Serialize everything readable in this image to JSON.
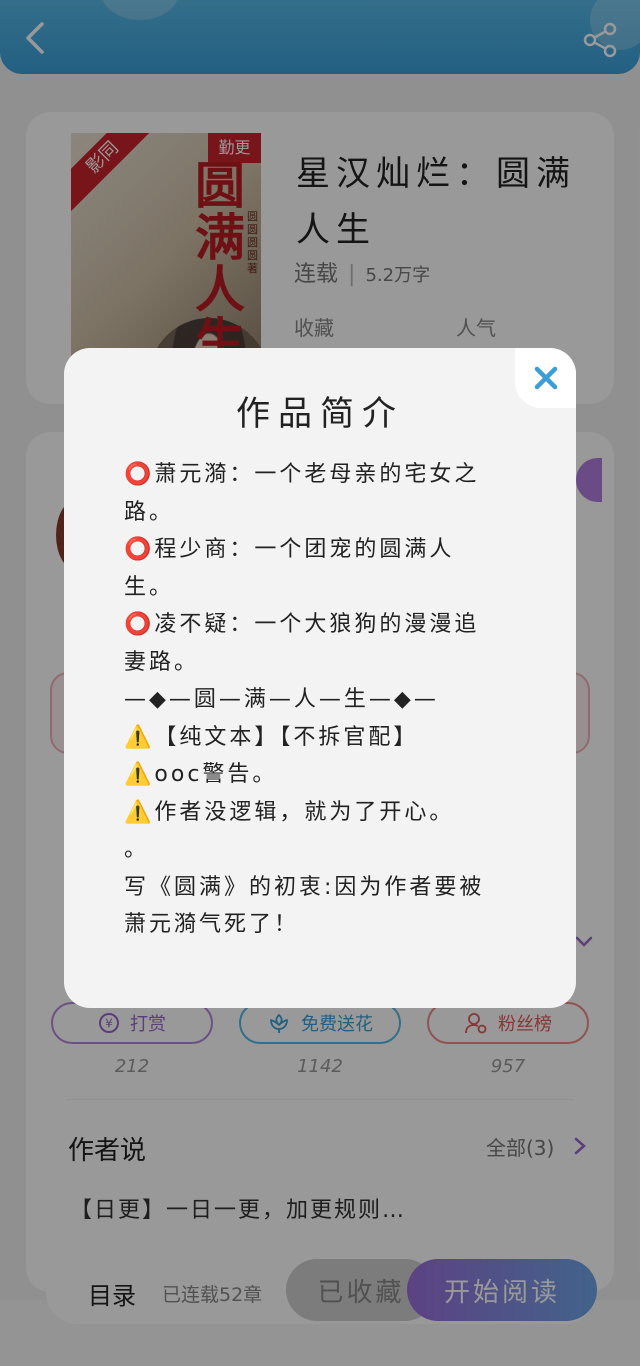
{
  "book": {
    "cover_ribbon": "影同",
    "cover_badge": "勤更",
    "cover_title": "圆满人生",
    "cover_author": "圆圆圆圆著",
    "title": "星汉灿烂：圆满人生",
    "status": "连载",
    "word_count": "5.2万字",
    "stat_favorites_label": "收藏",
    "stat_popularity_label": "人气"
  },
  "actions": [
    {
      "label": "打赏",
      "icon": "yen-coin-icon",
      "count": "212",
      "color": "#9a67cf"
    },
    {
      "label": "免费送花",
      "icon": "flower-icon",
      "count": "1142",
      "color": "#3a9fd8"
    },
    {
      "label": "粉丝榜",
      "icon": "person-badge-icon",
      "count": "957",
      "color": "#e35a5a"
    }
  ],
  "author_says": {
    "title": "作者说",
    "all_label": "全部(3)",
    "text": "【日更】一日一更，加更规则…"
  },
  "bottom_bar": {
    "toc_label": "目录",
    "toc_status": "已连载52章",
    "collected_label": "已收藏",
    "read_label": "开始阅读"
  },
  "modal": {
    "title": "作品简介",
    "lines": [
      "⭕萧元漪：一个老母亲的宅女之",
      "路。",
      "⭕程少商：一个团宠的圆满人",
      "生。",
      "⭕凌不疑：一个大狼狗的漫漫追",
      "妻路。",
      "—◆—圆—满—人—生—◆—",
      "⚠️【纯文本】【不拆官配】",
      "⚠️ooc警告。",
      "⚠️作者没逻辑，就为了开心。",
      "。",
      "写《圆满》的初衷:因为作者要被",
      "萧元漪气死了！"
    ]
  },
  "colors": {
    "header": "#3a9fd8",
    "accent_purple": "#9a6fdb",
    "accent_blue": "#56b7e6",
    "accent_red": "#ee8b8b",
    "close_icon": "#3a9fd8"
  }
}
